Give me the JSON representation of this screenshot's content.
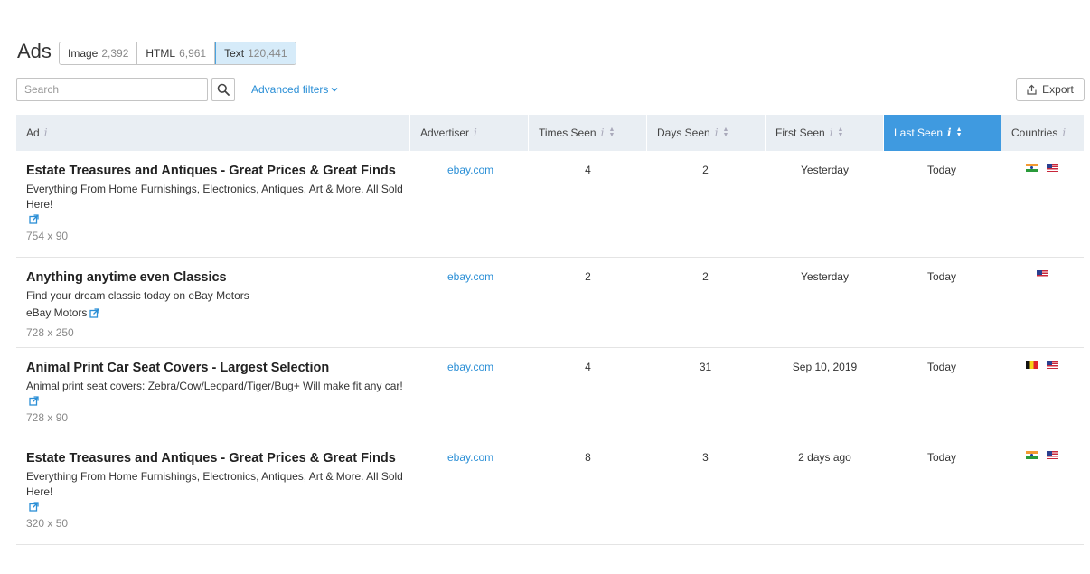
{
  "header": {
    "title": "Ads",
    "tabs": [
      {
        "label": "Image",
        "count": "2,392",
        "active": false
      },
      {
        "label": "HTML",
        "count": "6,961",
        "active": false
      },
      {
        "label": "Text",
        "count": "120,441",
        "active": true
      }
    ]
  },
  "search": {
    "placeholder": "Search",
    "value": ""
  },
  "filters": {
    "advanced_label": "Advanced filters"
  },
  "export": {
    "label": "Export"
  },
  "table": {
    "columns": [
      "Ad",
      "Advertiser",
      "Times Seen",
      "Days Seen",
      "First Seen",
      "Last Seen",
      "Countries"
    ],
    "rows": [
      {
        "title": "Estate Treasures and Antiques - Great Prices & Great Finds",
        "description": "Everything From Home Furnishings, Electronics, Antiques, Art & More. All Sold Here!",
        "link_text": "",
        "size": "754 x 90",
        "advertiser": "ebay.com",
        "times_seen": "4",
        "days_seen": "2",
        "first_seen": "Yesterday",
        "last_seen": "Today",
        "countries": [
          "in",
          "us"
        ]
      },
      {
        "title": "Anything anytime even Classics",
        "description": "Find your dream classic today on eBay Motors",
        "link_text": "eBay Motors",
        "size": "728 x 250",
        "advertiser": "ebay.com",
        "times_seen": "2",
        "days_seen": "2",
        "first_seen": "Yesterday",
        "last_seen": "Today",
        "countries": [
          "us"
        ]
      },
      {
        "title": "Animal Print Car Seat Covers - Largest Selection",
        "description": "Animal print seat covers: Zebra/Cow/Leopard/Tiger/Bug+ Will make fit any car!",
        "link_text": "",
        "size": "728 x 90",
        "advertiser": "ebay.com",
        "times_seen": "4",
        "days_seen": "31",
        "first_seen": "Sep 10, 2019",
        "last_seen": "Today",
        "countries": [
          "be",
          "us"
        ]
      },
      {
        "title": "Estate Treasures and Antiques - Great Prices & Great Finds",
        "description": "Everything From Home Furnishings, Electronics, Antiques, Art & More. All Sold Here!",
        "link_text": "",
        "size": "320 x 50",
        "advertiser": "ebay.com",
        "times_seen": "8",
        "days_seen": "3",
        "first_seen": "2 days ago",
        "last_seen": "Today",
        "countries": [
          "in",
          "us"
        ]
      }
    ]
  }
}
